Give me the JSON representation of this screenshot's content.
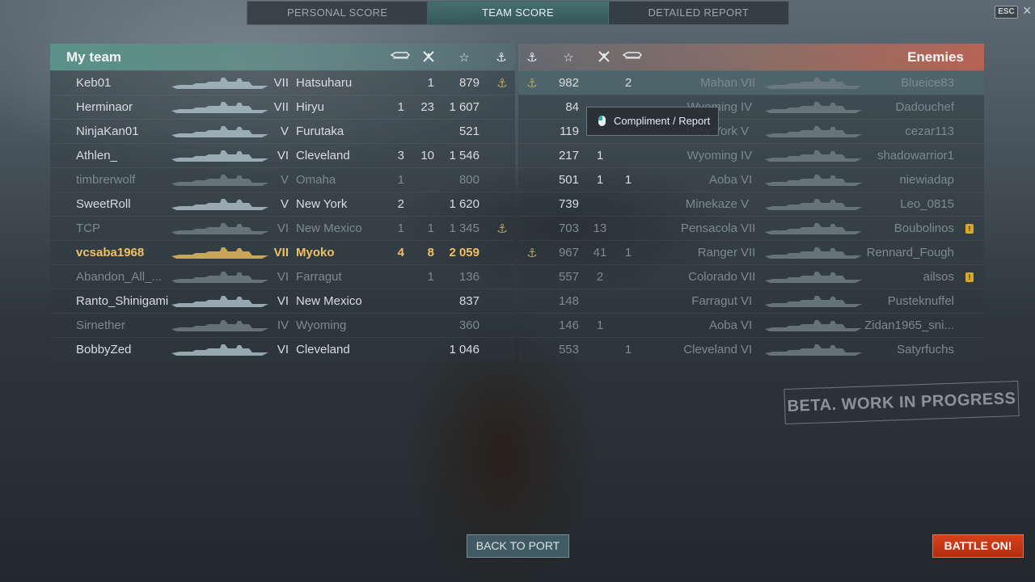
{
  "tabs": [
    "PERSONAL SCORE",
    "TEAM SCORE",
    "DETAILED REPORT"
  ],
  "active_tab": "TEAM SCORE",
  "esc_label": "ESC",
  "close_label": "×",
  "left_title": "My team",
  "right_title": "Enemies",
  "header_icons": [
    "torpedo-icon",
    "planes-destroyed-icon",
    "xp-star-icon",
    "anchor-icon"
  ],
  "my_team": [
    {
      "player": "Keb01",
      "tier": "VII",
      "ship": "Hatsuharu",
      "c1": "",
      "c2": "1",
      "xp": "879",
      "anchor": "⚓"
    },
    {
      "player": "Herminaor",
      "tier": "VII",
      "ship": "Hiryu",
      "c1": "1",
      "c2": "23",
      "xp": "1 607",
      "anchor": ""
    },
    {
      "player": "NinjaKan01",
      "tier": "V",
      "ship": "Furutaka",
      "c1": "",
      "c2": "",
      "xp": "521",
      "anchor": ""
    },
    {
      "player": "Athlen_",
      "tier": "VI",
      "ship": "Cleveland",
      "c1": "3",
      "c2": "10",
      "xp": "1 546",
      "anchor": ""
    },
    {
      "player": "timbrerwolf",
      "tier": "V",
      "ship": "Omaha",
      "c1": "1",
      "c2": "",
      "xp": "800",
      "anchor": ""
    },
    {
      "player": "SweetRoll",
      "tier": "V",
      "ship": "New York",
      "c1": "2",
      "c2": "",
      "xp": "1 620",
      "anchor": ""
    },
    {
      "player": "TCP",
      "tier": "VI",
      "ship": "New Mexico",
      "c1": "1",
      "c2": "1",
      "xp": "1 345",
      "anchor": "⚓"
    },
    {
      "player": "vcsaba1968",
      "tier": "VII",
      "ship": "Myoko",
      "c1": "4",
      "c2": "8",
      "xp": "2 059",
      "anchor": ""
    },
    {
      "player": "Abandon_All_...",
      "tier": "VI",
      "ship": "Farragut",
      "c1": "",
      "c2": "1",
      "xp": "136",
      "anchor": ""
    },
    {
      "player": "Ranto_Shinigami",
      "tier": "VI",
      "ship": "New Mexico",
      "c1": "",
      "c2": "",
      "xp": "837",
      "anchor": ""
    },
    {
      "player": "Sirnether",
      "tier": "IV",
      "ship": "Wyoming",
      "c1": "",
      "c2": "",
      "xp": "360",
      "anchor": ""
    },
    {
      "player": "BobbyZed",
      "tier": "VI",
      "ship": "Cleveland",
      "c1": "",
      "c2": "",
      "xp": "1 046",
      "anchor": ""
    }
  ],
  "enemies": [
    {
      "anchor": "⚓",
      "xp": "982",
      "c2": "",
      "c1": "2",
      "ship": "Mahan",
      "tier": "VII",
      "player": "Blueice83",
      "medal": ""
    },
    {
      "anchor": "",
      "xp": "84",
      "c2": "",
      "c1": "",
      "ship": "Wyoming",
      "tier": "IV",
      "player": "Dadouchef",
      "medal": ""
    },
    {
      "anchor": "",
      "xp": "119",
      "c2": "",
      "c1": "",
      "ship": "New York",
      "tier": "V",
      "player": "cezar113",
      "medal": ""
    },
    {
      "anchor": "",
      "xp": "217",
      "c2": "1",
      "c1": "",
      "ship": "Wyoming",
      "tier": "IV",
      "player": "shadowarrior1",
      "medal": ""
    },
    {
      "anchor": "",
      "xp": "501",
      "c2": "1",
      "c1": "1",
      "ship": "Aoba",
      "tier": "VI",
      "player": "niewiadap",
      "medal": ""
    },
    {
      "anchor": "",
      "xp": "739",
      "c2": "",
      "c1": "",
      "ship": "Minekaze",
      "tier": "V",
      "player": "Leo_0815",
      "medal": ""
    },
    {
      "anchor": "",
      "xp": "703",
      "c2": "13",
      "c1": "",
      "ship": "Pensacola",
      "tier": "VII",
      "player": "Boubolinos",
      "medal": "!"
    },
    {
      "anchor": "⚓",
      "xp": "967",
      "c2": "41",
      "c1": "1",
      "ship": "Ranger",
      "tier": "VII",
      "player": "Rennard_Fough",
      "medal": ""
    },
    {
      "anchor": "",
      "xp": "557",
      "c2": "2",
      "c1": "",
      "ship": "Colorado",
      "tier": "VII",
      "player": "ailsos",
      "medal": "!"
    },
    {
      "anchor": "",
      "xp": "148",
      "c2": "",
      "c1": "",
      "ship": "Farragut",
      "tier": "VI",
      "player": "Pusteknuffel",
      "medal": ""
    },
    {
      "anchor": "",
      "xp": "146",
      "c2": "1",
      "c1": "",
      "ship": "Aoba",
      "tier": "VI",
      "player": "Zidan1965_sni...",
      "medal": ""
    },
    {
      "anchor": "",
      "xp": "553",
      "c2": "",
      "c1": "1",
      "ship": "Cleveland",
      "tier": "VI",
      "player": "Satyrfuchs",
      "medal": ""
    }
  ],
  "tooltip": "Compliment / Report",
  "beta_label": "BETA. WORK IN PROGRESS",
  "back_button": "BACK TO PORT",
  "battle_button": "BATTLE ON!",
  "colors": {
    "accent_teal": "#4f8f8c",
    "enemy_red": "#c8644e",
    "player_gold": "#f2c061",
    "battle_button": "#c8381a"
  }
}
